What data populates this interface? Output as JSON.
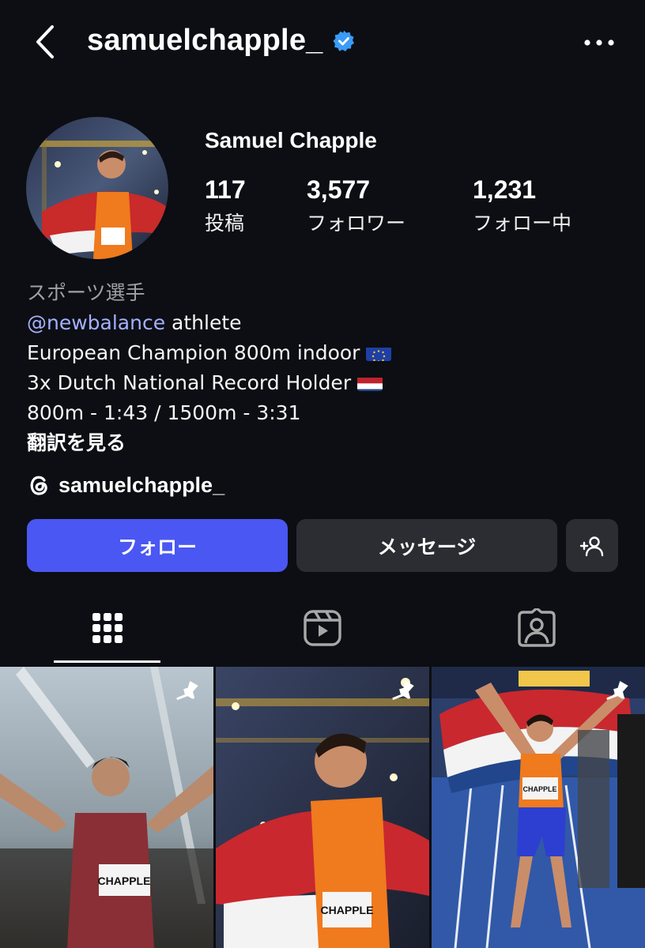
{
  "header": {
    "username": "samuelchapple_",
    "verified": true,
    "back_icon": "chevron-left-icon",
    "more_icon": "more-horizontal-icon"
  },
  "profile": {
    "display_name": "Samuel Chapple",
    "stats": [
      {
        "value": "117",
        "label": "投稿"
      },
      {
        "value": "3,577",
        "label": "フォロワー"
      },
      {
        "value": "1,231",
        "label": "フォロー中"
      }
    ]
  },
  "bio": {
    "category": "スポーツ選手",
    "mention": "@newbalance",
    "mention_suffix": " athlete",
    "line2": "European Champion 800m indoor",
    "line3": "3x Dutch National Record Holder",
    "line4": "800m - 1:43 / 1500m - 3:31",
    "translate": "翻訳を見る"
  },
  "threads": {
    "handle": "samuelchapple_",
    "icon": "threads-icon"
  },
  "actions": {
    "follow_label": "フォロー",
    "message_label": "メッセージ",
    "add_icon": "add-person-icon"
  },
  "tabs": [
    {
      "name": "grid",
      "icon": "grid-icon",
      "active": true
    },
    {
      "name": "reels",
      "icon": "reels-icon",
      "active": false
    },
    {
      "name": "tagged",
      "icon": "tagged-person-icon",
      "active": false
    }
  ],
  "posts": [
    {
      "pinned": true,
      "bib": "CHAPPLE"
    },
    {
      "pinned": true,
      "bib": "CHAPPLE"
    },
    {
      "pinned": true,
      "bib": "CHAPPLE"
    }
  ],
  "colors": {
    "background": "#0c0e13",
    "follow_button": "#4a57f2",
    "secondary_button": "#2b2d33",
    "mention": "#a5b0ff",
    "verified": "#3b9bf7"
  }
}
